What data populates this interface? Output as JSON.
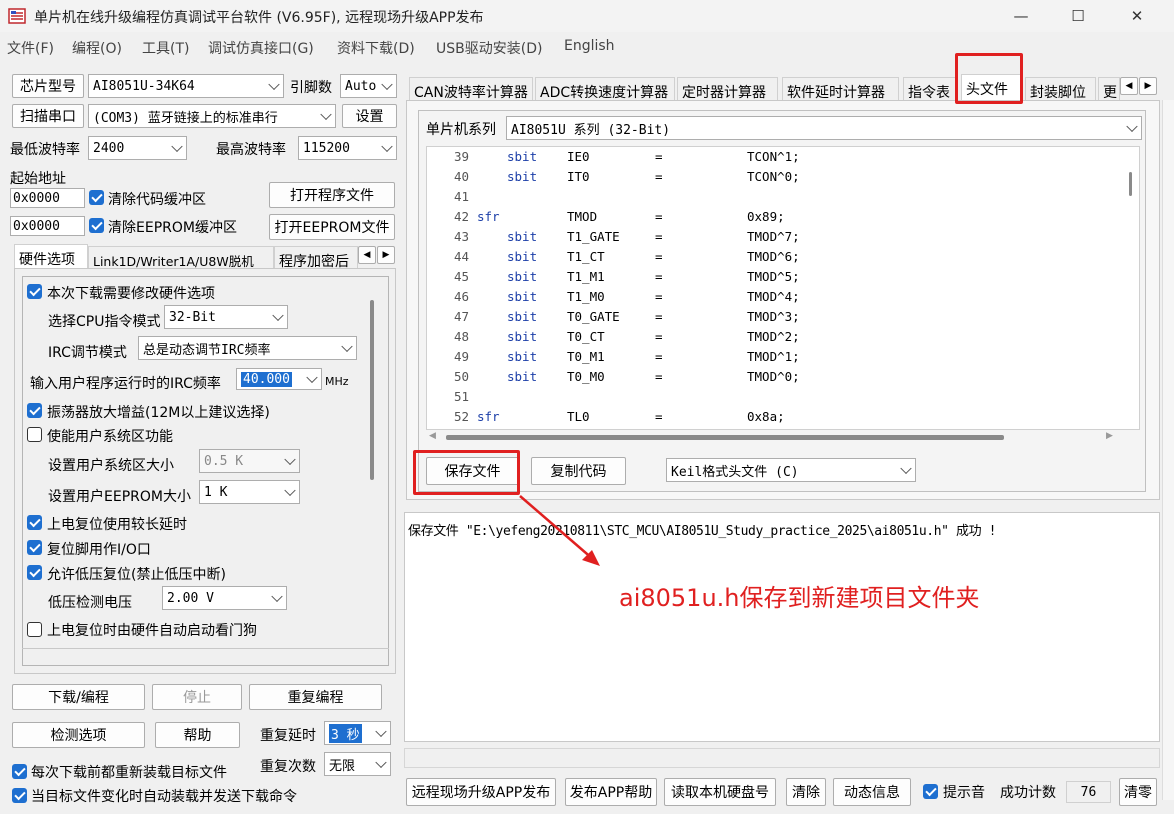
{
  "window": {
    "title": "单片机在线升级编程仿真调试平台软件 (V6.95F), 远程现场升级APP发布",
    "minimize": "—",
    "maximize": "☐",
    "close": "✕"
  },
  "menu": [
    "文件(F)",
    "编程(O)",
    "工具(T)",
    "调试仿真接口(G)",
    "资料下载(D)",
    "USB驱动安装(D)",
    "English"
  ],
  "left": {
    "chip_label": "芯片型号",
    "chip_value": "AI8051U-34K64",
    "pins_label": "引脚数",
    "pins_value": "Auto",
    "scan_button": "扫描串口",
    "port_value": "(COM3) 蓝牙链接上的标准串行",
    "settings_button": "设置",
    "min_baud_label": "最低波特率",
    "min_baud_value": "2400",
    "max_baud_label": "最高波特率",
    "max_baud_value": "115200",
    "start_addr_label": "起始地址",
    "addr1": "0x0000",
    "clear_code_label": "清除代码缓冲区",
    "open_prog_button": "打开程序文件",
    "addr2": "0x0000",
    "clear_eeprom_label": "清除EEPROM缓冲区",
    "open_eeprom_button": "打开EEPROM文件",
    "tabs": [
      "硬件选项",
      "Link1D/Writer1A/U8W脱机",
      "程序加密后"
    ],
    "hw": {
      "modify_hw": "本次下载需要修改硬件选项",
      "cpu_mode_label": "选择CPU指令模式",
      "cpu_mode_value": "32-Bit",
      "irc_mode_label": "IRC调节模式",
      "irc_mode_value": "总是动态调节IRC频率",
      "irc_freq_label": "输入用户程序运行时的IRC频率",
      "irc_freq_value": "40.000",
      "irc_unit": "MHz",
      "osc_gain": "振荡器放大增益(12M以上建议选择)",
      "enable_sys": "使能用户系统区功能",
      "sys_size_label": "设置用户系统区大小",
      "sys_size_value": "0.5 K",
      "eeprom_size_label": "设置用户EEPROM大小",
      "eeprom_size_value": "1   K",
      "long_delay": "上电复位使用较长延时",
      "reset_io": "复位脚用作I/O口",
      "low_volt_reset": "允许低压复位(禁止低压中断)",
      "low_volt_label": "低压检测电压",
      "low_volt_value": "2.00 V",
      "watchdog": "上电复位时由硬件自动启动看门狗"
    },
    "download_button": "下载/编程",
    "stop_button": "停止",
    "reprogram_button": "重复编程",
    "detect_button": "检测选项",
    "help_button": "帮助",
    "repeat_delay_label": "重复延时",
    "repeat_delay_value": "3 秒",
    "repeat_count_label": "重复次数",
    "repeat_count_value": "无限",
    "reload_each": "每次下载前都重新装载目标文件",
    "auto_reload": "当目标文件变化时自动装载并发送下载命令"
  },
  "right": {
    "tabs": [
      "CAN波特率计算器",
      "ADC转换速度计算器",
      "定时器计算器",
      "软件延时计算器",
      "指令表",
      "头文件",
      "封装脚位",
      "更"
    ],
    "series_label": "单片机系列",
    "series_value": "AI8051U 系列 (32-Bit)",
    "code": [
      {
        "ln": "39",
        "kw": "sbit",
        "name": "IE0",
        "eq": "=",
        "val": "TCON^1;"
      },
      {
        "ln": "40",
        "kw": "sbit",
        "name": "IT0",
        "eq": "=",
        "val": "TCON^0;"
      },
      {
        "ln": "41",
        "kw": "",
        "name": "",
        "eq": "",
        "val": ""
      },
      {
        "ln": "42",
        "kw": "sfr",
        "name": "TMOD",
        "eq": "=",
        "val": "0x89;"
      },
      {
        "ln": "43",
        "kw": "sbit",
        "name": "T1_GATE",
        "eq": "=",
        "val": "TMOD^7;"
      },
      {
        "ln": "44",
        "kw": "sbit",
        "name": "T1_CT",
        "eq": "=",
        "val": "TMOD^6;"
      },
      {
        "ln": "45",
        "kw": "sbit",
        "name": "T1_M1",
        "eq": "=",
        "val": "TMOD^5;"
      },
      {
        "ln": "46",
        "kw": "sbit",
        "name": "T1_M0",
        "eq": "=",
        "val": "TMOD^4;"
      },
      {
        "ln": "47",
        "kw": "sbit",
        "name": "T0_GATE",
        "eq": "=",
        "val": "TMOD^3;"
      },
      {
        "ln": "48",
        "kw": "sbit",
        "name": "T0_CT",
        "eq": "=",
        "val": "TMOD^2;"
      },
      {
        "ln": "49",
        "kw": "sbit",
        "name": "T0_M1",
        "eq": "=",
        "val": "TMOD^1;"
      },
      {
        "ln": "50",
        "kw": "sbit",
        "name": "T0_M0",
        "eq": "=",
        "val": "TMOD^0;"
      },
      {
        "ln": "51",
        "kw": "",
        "name": "",
        "eq": "",
        "val": ""
      },
      {
        "ln": "52",
        "kw": "sfr",
        "name": "TL0",
        "eq": "=",
        "val": "0x8a;"
      }
    ],
    "save_button": "保存文件",
    "copy_button": "复制代码",
    "format_value": "Keil格式头文件 (C)",
    "output_text": "保存文件 \"E:\\yefeng20210811\\STC_MCU\\AI8051U_Study_practice_2025\\ai8051u.h\" 成功 !",
    "annotation": "ai8051u.h保存到新建项目文件夹"
  },
  "bottom": {
    "remote_button": "远程现场升级APP发布",
    "publish_help_button": "发布APP帮助",
    "read_disk_button": "读取本机硬盘号",
    "clear_button": "清除",
    "dynamic_button": "动态信息",
    "beep_label": "提示音",
    "count_label": "成功计数",
    "count_value": "76",
    "reset_count_button": "清零"
  },
  "colors": {
    "highlight": "#e02020",
    "check": "#1e6fd0",
    "keyword": "#1c3fa8"
  }
}
